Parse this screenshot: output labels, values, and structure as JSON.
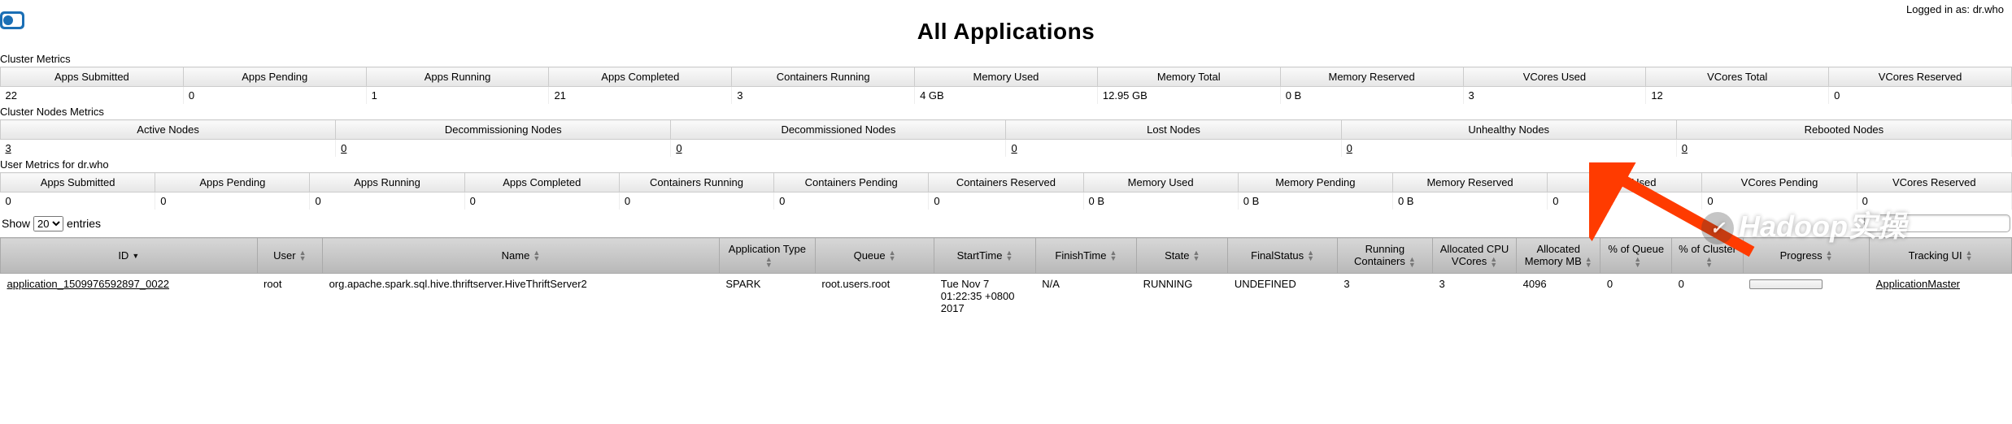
{
  "header": {
    "login_label": "Logged in as:",
    "login_user": "dr.who",
    "title": "All Applications"
  },
  "cluster_metrics": {
    "label": "Cluster Metrics",
    "headers": [
      "Apps Submitted",
      "Apps Pending",
      "Apps Running",
      "Apps Completed",
      "Containers Running",
      "Memory Used",
      "Memory Total",
      "Memory Reserved",
      "VCores Used",
      "VCores Total",
      "VCores Reserved"
    ],
    "values": [
      "22",
      "0",
      "1",
      "21",
      "3",
      "4 GB",
      "12.95 GB",
      "0 B",
      "3",
      "12",
      "0"
    ]
  },
  "cluster_nodes": {
    "label": "Cluster Nodes Metrics",
    "headers": [
      "Active Nodes",
      "Decommissioning Nodes",
      "Decommissioned Nodes",
      "Lost Nodes",
      "Unhealthy Nodes",
      "Rebooted Nodes"
    ],
    "values": [
      "3",
      "0",
      "0",
      "0",
      "0",
      "0"
    ]
  },
  "user_metrics": {
    "label": "User Metrics for dr.who",
    "headers": [
      "Apps Submitted",
      "Apps Pending",
      "Apps Running",
      "Apps Completed",
      "Containers Running",
      "Containers Pending",
      "Containers Reserved",
      "Memory Used",
      "Memory Pending",
      "Memory Reserved",
      "VCores Used",
      "VCores Pending",
      "VCores Reserved"
    ],
    "values": [
      "0",
      "0",
      "0",
      "0",
      "0",
      "0",
      "0",
      "0 B",
      "0 B",
      "0 B",
      "0",
      "0",
      "0"
    ]
  },
  "entries": {
    "show": "Show",
    "count": "20",
    "suffix": "entries"
  },
  "apps_table": {
    "headers": [
      "ID",
      "User",
      "Name",
      "Application Type",
      "Queue",
      "StartTime",
      "FinishTime",
      "State",
      "FinalStatus",
      "Running Containers",
      "Allocated CPU VCores",
      "Allocated Memory MB",
      "% of Queue",
      "% of Cluster",
      "Progress",
      "Tracking UI"
    ],
    "row": {
      "id": "application_1509976592897_0022",
      "user": "root",
      "name": "org.apache.spark.sql.hive.thriftserver.HiveThriftServer2",
      "type": "SPARK",
      "queue": "root.users.root",
      "start": "Tue Nov 7 01:22:35 +0800 2017",
      "finish": "N/A",
      "state": "RUNNING",
      "final": "UNDEFINED",
      "containers": "3",
      "vcores": "3",
      "memory": "4096",
      "pct_queue": "0",
      "pct_cluster": "0",
      "tracking": "ApplicationMaster"
    }
  },
  "watermark": "Hadoop实操"
}
